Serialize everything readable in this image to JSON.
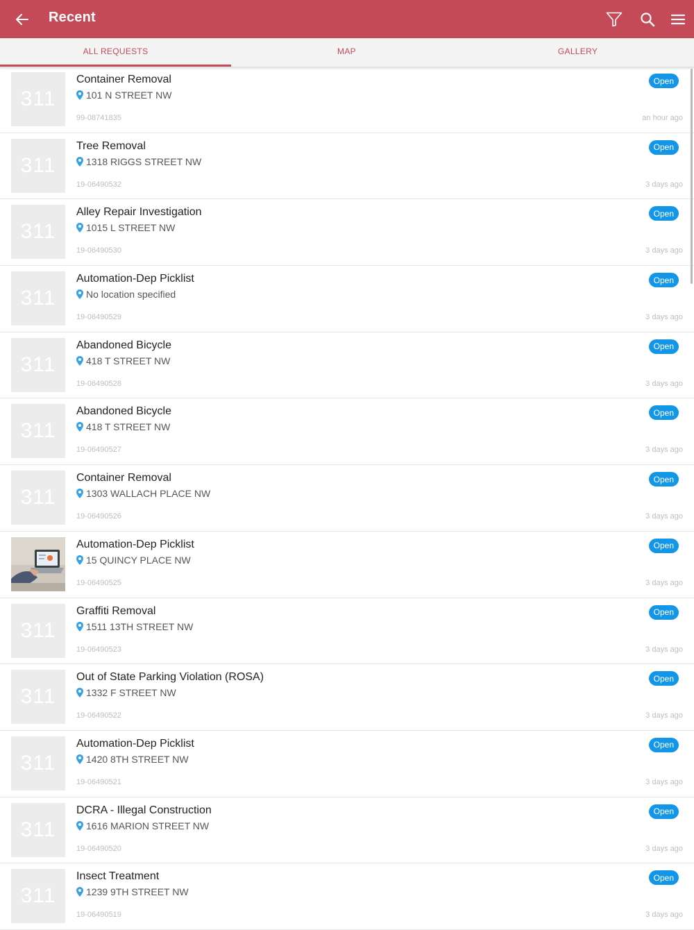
{
  "appbar": {
    "title": "Recent",
    "background": "#c44a58",
    "back_icon": "arrow-left-icon",
    "actions": [
      "filter-icon",
      "search-icon",
      "menu-icon"
    ]
  },
  "tabs": [
    {
      "label": "ALL REQUESTS",
      "active": true
    },
    {
      "label": "MAP",
      "active": false
    },
    {
      "label": "GALLERY",
      "active": false
    }
  ],
  "placeholder_text": "311",
  "status_color": "#1396e8",
  "requests": [
    {
      "title": "Container Removal",
      "location": "101 N STREET NW",
      "id": "99-08741835",
      "time": "an hour ago",
      "status": "Open",
      "has_photo": false
    },
    {
      "title": "Tree Removal",
      "location": "1318 RIGGS STREET NW",
      "id": "19-06490532",
      "time": "3 days ago",
      "status": "Open",
      "has_photo": false
    },
    {
      "title": "Alley Repair Investigation",
      "location": "1015 L STREET NW",
      "id": "19-06490530",
      "time": "3 days ago",
      "status": "Open",
      "has_photo": false
    },
    {
      "title": "Automation-Dep Picklist",
      "location": "No location specified",
      "id": "19-06490529",
      "time": "3 days ago",
      "status": "Open",
      "has_photo": false
    },
    {
      "title": "Abandoned Bicycle",
      "location": "418 T STREET NW",
      "id": "19-06490528",
      "time": "3 days ago",
      "status": "Open",
      "has_photo": false
    },
    {
      "title": "Abandoned Bicycle",
      "location": "418 T STREET NW",
      "id": "19-06490527",
      "time": "3 days ago",
      "status": "Open",
      "has_photo": false
    },
    {
      "title": "Container Removal",
      "location": "1303 WALLACH PLACE NW",
      "id": "19-06490526",
      "time": "3 days ago",
      "status": "Open",
      "has_photo": false
    },
    {
      "title": "Automation-Dep Picklist",
      "location": "15 QUINCY PLACE NW",
      "id": "19-06490525",
      "time": "3 days ago",
      "status": "Open",
      "has_photo": true
    },
    {
      "title": "Graffiti Removal",
      "location": "1511 13TH STREET NW",
      "id": "19-06490523",
      "time": "3 days ago",
      "status": "Open",
      "has_photo": false
    },
    {
      "title": "Out of State Parking Violation (ROSA)",
      "location": "1332 F STREET NW",
      "id": "19-06490522",
      "time": "3 days ago",
      "status": "Open",
      "has_photo": false
    },
    {
      "title": "Automation-Dep Picklist",
      "location": "1420 8TH STREET NW",
      "id": "19-06490521",
      "time": "3 days ago",
      "status": "Open",
      "has_photo": false
    },
    {
      "title": "DCRA - Illegal Construction",
      "location": "1616 MARION STREET NW",
      "id": "19-06490520",
      "time": "3 days ago",
      "status": "Open",
      "has_photo": false
    },
    {
      "title": "Insect Treatment",
      "location": "1239 9TH STREET NW",
      "id": "19-06490519",
      "time": "3 days ago",
      "status": "Open",
      "has_photo": false
    }
  ]
}
